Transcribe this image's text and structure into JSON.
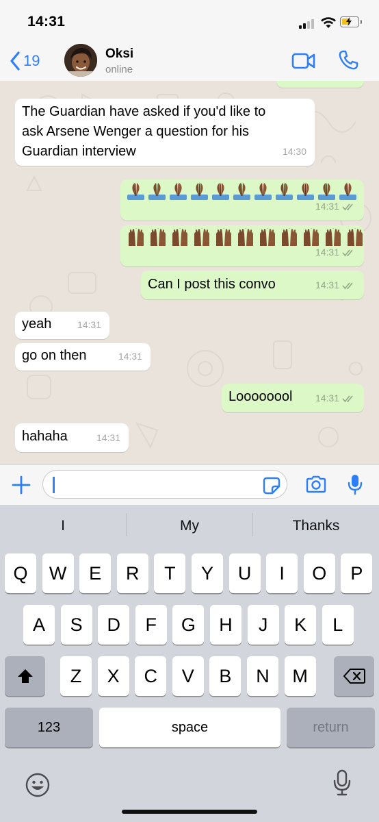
{
  "status_bar": {
    "time": "14:31"
  },
  "header": {
    "back_count": "19",
    "contact_name": "Oksi",
    "contact_status": "online",
    "icons": [
      "chevron-left-icon",
      "video-call-icon",
      "phone-icon"
    ]
  },
  "messages": [
    {
      "direction": "incoming",
      "text_lines": [
        "The Guardian have asked if you'd like to",
        "ask Arsene Wenger a question for his",
        "Guardian interview"
      ],
      "time": "14:30"
    },
    {
      "direction": "outgoing",
      "emoji": "folded-hands",
      "emoji_count": 11,
      "time": "14:31",
      "status": "read"
    },
    {
      "direction": "outgoing",
      "emoji": "raising-hands",
      "emoji_count": 11,
      "time": "14:31",
      "status": "read"
    },
    {
      "direction": "outgoing",
      "text": "Can I post this convo",
      "time": "14:31",
      "status": "read"
    },
    {
      "direction": "incoming",
      "text": "yeah",
      "time": "14:31"
    },
    {
      "direction": "incoming",
      "text": "go on then",
      "time": "14:31"
    },
    {
      "direction": "outgoing",
      "text": "Loooooool",
      "time": "14:31",
      "status": "read"
    },
    {
      "direction": "incoming",
      "text": "hahaha",
      "time": "14:31"
    }
  ],
  "input": {
    "value": "",
    "placeholder": ""
  },
  "keyboard": {
    "suggestions": [
      "I",
      "My",
      "Thanks"
    ],
    "row1": [
      "Q",
      "W",
      "E",
      "R",
      "T",
      "Y",
      "U",
      "I",
      "O",
      "P"
    ],
    "row2": [
      "A",
      "S",
      "D",
      "F",
      "G",
      "H",
      "J",
      "K",
      "L"
    ],
    "row3": [
      "Z",
      "X",
      "C",
      "V",
      "B",
      "N",
      "M"
    ],
    "numbers_label": "123",
    "space_label": "space",
    "return_label": "return"
  },
  "colors": {
    "accent": "#2d7ff9",
    "outgoing_bubble": "#dcf8c6",
    "incoming_bubble": "#ffffff",
    "chat_background": "#e9e3dc",
    "read_ticks": "#93a68a",
    "battery": "#f1c21b"
  }
}
